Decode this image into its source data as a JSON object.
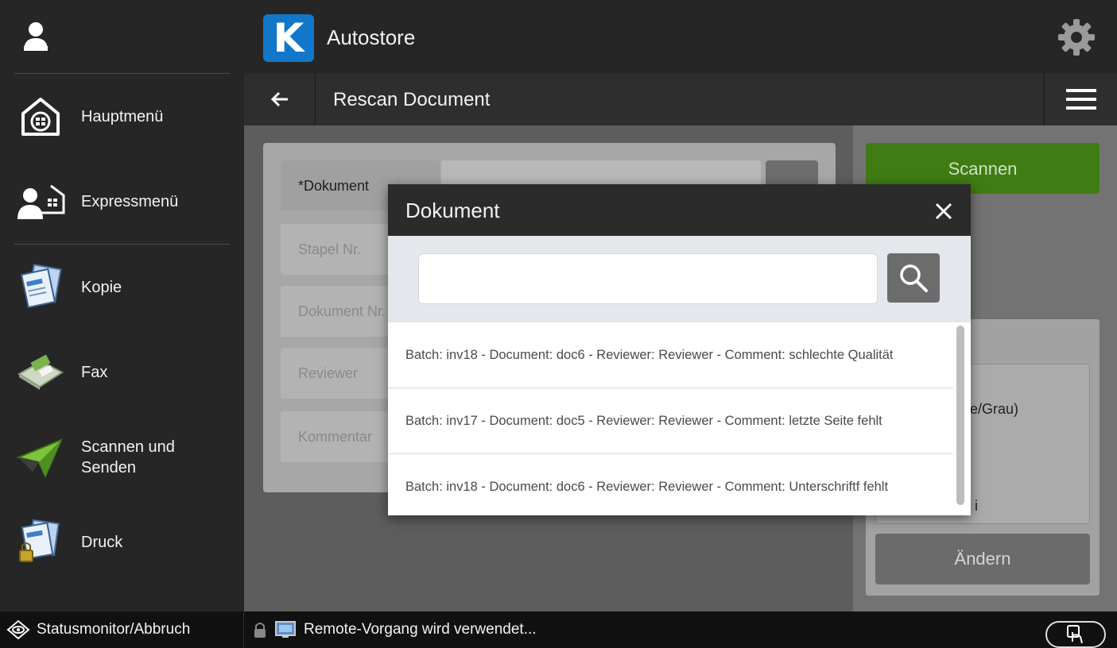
{
  "app": {
    "title": "Autostore",
    "logo_letter": "K"
  },
  "subheader": {
    "title": "Rescan Document"
  },
  "sidebar": {
    "items": [
      {
        "label": "Hauptmenü",
        "icon": "home-icon"
      },
      {
        "label": "Expressmenü",
        "icon": "express-user-icon"
      },
      {
        "label": "Kopie",
        "icon": "copy-icon"
      },
      {
        "label": "Fax",
        "icon": "fax-icon"
      },
      {
        "label": "Scannen und Senden",
        "icon": "scan-send-icon"
      },
      {
        "label": "Druck",
        "icon": "print-icon"
      }
    ]
  },
  "form": {
    "fields": [
      {
        "label": "*Dokument",
        "active": true
      },
      {
        "label": "Stapel Nr."
      },
      {
        "label": "Dokument Nr."
      },
      {
        "label": "Reviewer"
      },
      {
        "label": "Kommentar"
      }
    ]
  },
  "right_panel": {
    "scan_label": "Scannen",
    "color_mode_partial": "be/Grau)",
    "dpi_partial": "i",
    "change_label": "Ändern"
  },
  "modal": {
    "title": "Dokument",
    "search_value": "",
    "results": [
      "Batch: inv18 - Document: doc6 - Reviewer: Reviewer - Comment: schlechte Qualität",
      "Batch: inv17 - Document: doc5 - Reviewer: Reviewer - Comment: letzte Seite fehlt",
      "Batch: inv18 - Document: doc6 - Reviewer: Reviewer - Comment:  Unterschriftf fehlt"
    ]
  },
  "statusbar": {
    "monitor_label": "Statusmonitor/Abbruch",
    "remote_label": "Remote-Vorgang wird verwendet..."
  },
  "colors": {
    "accent_green": "#3f7c14",
    "logo_blue": "#1277c8",
    "dark_bg": "#262626"
  }
}
